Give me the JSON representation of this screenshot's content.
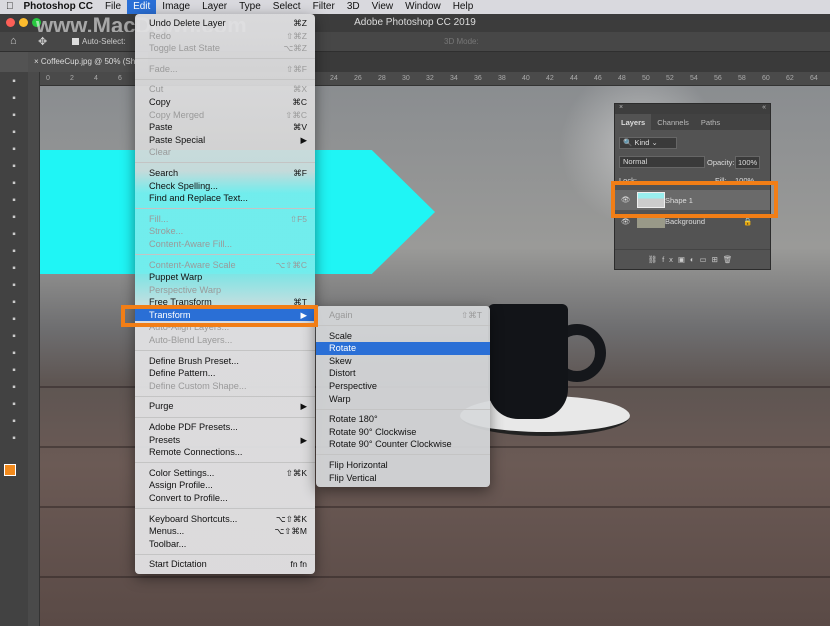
{
  "menubar": {
    "app": "Photoshop CC",
    "items": [
      "File",
      "Edit",
      "Image",
      "Layer",
      "Type",
      "Select",
      "Filter",
      "3D",
      "View",
      "Window",
      "Help"
    ]
  },
  "window_title": "Adobe Photoshop CC 2019",
  "watermark": "www.MacDown.com",
  "options_bar": {
    "auto_select": "Auto-Select:",
    "mode3d": "3D Mode:"
  },
  "document_tab": "CoffeeCup.jpg @ 50% (Sh",
  "ruler_ticks": [
    "0",
    "2",
    "4",
    "6",
    "24",
    "26",
    "28",
    "30",
    "32",
    "34",
    "36",
    "38",
    "40",
    "42",
    "44",
    "46",
    "48",
    "50",
    "52",
    "54",
    "56",
    "58",
    "60",
    "62",
    "64"
  ],
  "edit_menu": [
    {
      "label": "Undo Delete Layer",
      "shortcut": "⌘Z"
    },
    {
      "label": "Redo",
      "shortcut": "⇧⌘Z",
      "disabled": true
    },
    {
      "label": "Toggle Last State",
      "shortcut": "⌥⌘Z",
      "disabled": true
    },
    {
      "sep": true
    },
    {
      "label": "Fade...",
      "shortcut": "⇧⌘F",
      "disabled": true
    },
    {
      "sep": true
    },
    {
      "label": "Cut",
      "shortcut": "⌘X",
      "disabled": true
    },
    {
      "label": "Copy",
      "shortcut": "⌘C"
    },
    {
      "label": "Copy Merged",
      "shortcut": "⇧⌘C",
      "disabled": true
    },
    {
      "label": "Paste",
      "shortcut": "⌘V"
    },
    {
      "label": "Paste Special",
      "shortcut": "▶"
    },
    {
      "label": "Clear",
      "shortcut": "",
      "disabled": true
    },
    {
      "sep": true
    },
    {
      "label": "Search",
      "shortcut": "⌘F"
    },
    {
      "label": "Check Spelling...",
      "shortcut": ""
    },
    {
      "label": "Find and Replace Text...",
      "shortcut": ""
    },
    {
      "sep": true
    },
    {
      "label": "Fill...",
      "shortcut": "⇧F5",
      "disabled": true
    },
    {
      "label": "Stroke...",
      "shortcut": "",
      "disabled": true
    },
    {
      "label": "Content-Aware Fill...",
      "shortcut": "",
      "disabled": true
    },
    {
      "sep": true
    },
    {
      "label": "Content-Aware Scale",
      "shortcut": "⌥⇧⌘C",
      "disabled": true
    },
    {
      "label": "Puppet Warp",
      "shortcut": ""
    },
    {
      "label": "Perspective Warp",
      "shortcut": "",
      "disabled": true
    },
    {
      "label": "Free Transform",
      "shortcut": "⌘T"
    },
    {
      "label": "Transform",
      "shortcut": "▶",
      "highlighted": true
    },
    {
      "label": "Auto-Align Layers...",
      "shortcut": "",
      "disabled": true
    },
    {
      "label": "Auto-Blend Layers...",
      "shortcut": "",
      "disabled": true
    },
    {
      "sep": true
    },
    {
      "label": "Define Brush Preset...",
      "shortcut": ""
    },
    {
      "label": "Define Pattern...",
      "shortcut": ""
    },
    {
      "label": "Define Custom Shape...",
      "shortcut": "",
      "disabled": true
    },
    {
      "sep": true
    },
    {
      "label": "Purge",
      "shortcut": "▶"
    },
    {
      "sep": true
    },
    {
      "label": "Adobe PDF Presets...",
      "shortcut": ""
    },
    {
      "label": "Presets",
      "shortcut": "▶"
    },
    {
      "label": "Remote Connections...",
      "shortcut": ""
    },
    {
      "sep": true
    },
    {
      "label": "Color Settings...",
      "shortcut": "⇧⌘K"
    },
    {
      "label": "Assign Profile...",
      "shortcut": ""
    },
    {
      "label": "Convert to Profile...",
      "shortcut": ""
    },
    {
      "sep": true
    },
    {
      "label": "Keyboard Shortcuts...",
      "shortcut": "⌥⇧⌘K"
    },
    {
      "label": "Menus...",
      "shortcut": "⌥⇧⌘M"
    },
    {
      "label": "Toolbar...",
      "shortcut": ""
    },
    {
      "sep": true
    },
    {
      "label": "Start Dictation",
      "shortcut": "fn fn"
    }
  ],
  "transform_submenu": [
    {
      "label": "Again",
      "shortcut": "⇧⌘T",
      "disabled": true
    },
    {
      "sep": true
    },
    {
      "label": "Scale"
    },
    {
      "label": "Rotate",
      "highlighted": true
    },
    {
      "label": "Skew"
    },
    {
      "label": "Distort"
    },
    {
      "label": "Perspective"
    },
    {
      "label": "Warp"
    },
    {
      "sep": true
    },
    {
      "label": "Rotate 180°"
    },
    {
      "label": "Rotate 90° Clockwise"
    },
    {
      "label": "Rotate 90° Counter Clockwise"
    },
    {
      "sep": true
    },
    {
      "label": "Flip Horizontal"
    },
    {
      "label": "Flip Vertical"
    }
  ],
  "layers_panel": {
    "tabs": [
      "Layers",
      "Channels",
      "Paths"
    ],
    "filter": "Kind",
    "blend_mode": "Normal",
    "opacity_label": "Opacity:",
    "opacity": "100%",
    "lock_label": "Lock:",
    "fill_label": "Fill:",
    "fill": "100%",
    "layers": [
      {
        "name": "Shape 1",
        "selected": true
      },
      {
        "name": "Background",
        "locked": true
      }
    ]
  },
  "colors": {
    "accent": "#2a6fd6",
    "highlight_box": "#f27e16",
    "shape": "#1ff5f5"
  }
}
